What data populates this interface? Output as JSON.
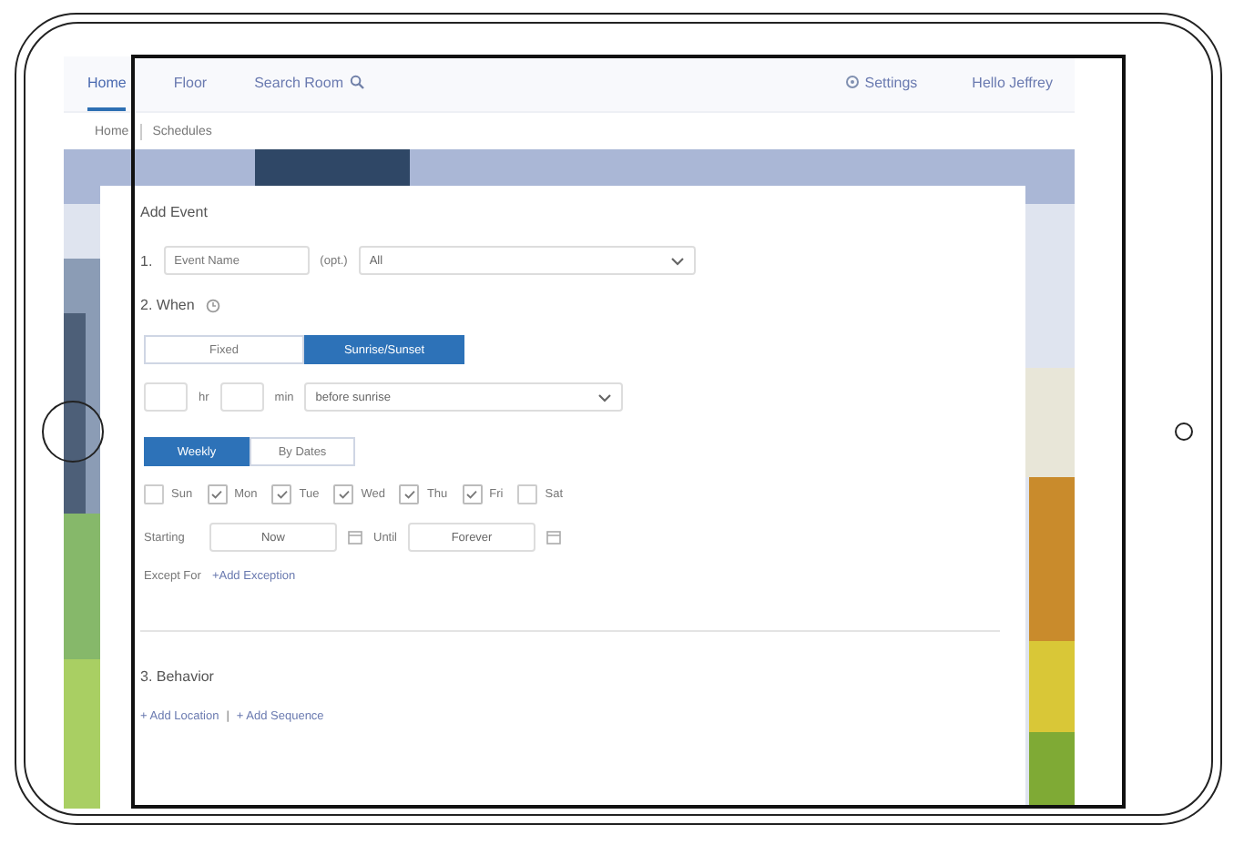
{
  "nav": {
    "items": [
      {
        "label": "Home",
        "selected": true
      },
      {
        "label": "Floor",
        "selected": false
      },
      {
        "label": "Search Room",
        "selected": false
      }
    ],
    "settings": "Settings",
    "greeting": "Hello Jeffrey"
  },
  "breadcrumb": [
    "Home",
    "Schedules"
  ],
  "form": {
    "title": "Add Event",
    "name_step": {
      "number": "1.",
      "placeholder": "Event Name",
      "hint": "(opt.)",
      "select": "All"
    },
    "when": {
      "heading": "2. When",
      "modes": [
        {
          "label": "Fixed",
          "selected": false
        },
        {
          "label": "Sunrise/Sunset",
          "selected": true
        }
      ],
      "offset": {
        "hours_unit": "hr",
        "minutes_unit": "min",
        "relation": "before sunrise"
      },
      "repeat": [
        {
          "label": "Weekly",
          "selected": true
        },
        {
          "label": "By Dates",
          "selected": false
        }
      ],
      "days": [
        {
          "label": "Sun",
          "checked": false
        },
        {
          "label": "Mon",
          "checked": true
        },
        {
          "label": "Tue",
          "checked": true
        },
        {
          "label": "Wed",
          "checked": true
        },
        {
          "label": "Thu",
          "checked": true
        },
        {
          "label": "Fri",
          "checked": true
        },
        {
          "label": "Sat",
          "checked": false
        }
      ],
      "starting_label": "Starting",
      "starting": "Now",
      "until_label": "Until",
      "until": "Forever",
      "except_label": "Except For",
      "except_link": "+Add Exception"
    },
    "behavior": {
      "heading": "3. Behavior",
      "links": [
        "+ Add Location",
        "+ Add Sequence"
      ],
      "separator": "|"
    }
  }
}
